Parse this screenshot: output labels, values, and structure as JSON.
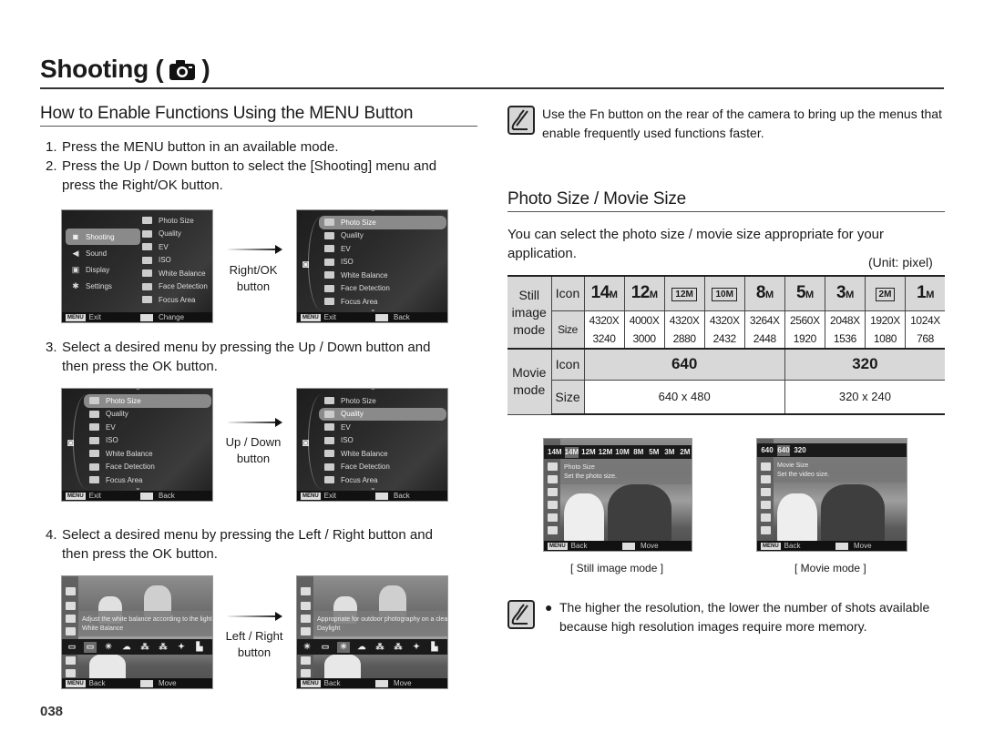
{
  "header": {
    "title": "Shooting (",
    "title_close": ")",
    "title_icon": "camera-icon"
  },
  "left": {
    "section_title": "How to Enable Functions Using the MENU Button",
    "steps": [
      {
        "num": "1.",
        "line1": "Press the MENU button in an available mode.",
        "line2": ""
      },
      {
        "num": "2.",
        "line1": "Press the Up / Down button to select the [Shooting] menu and",
        "line2": "press the Right/OK button."
      },
      {
        "num": "3.",
        "line1": "Select a desired menu by pressing the Up / Down button and",
        "line2": "then press the OK button."
      },
      {
        "num": "4.",
        "line1": "Select a desired menu by pressing the Left / Right button and",
        "line2": "then press the OK button."
      }
    ],
    "transitions": [
      {
        "line1": "Right/OK",
        "line2": "button"
      },
      {
        "line1": "Up / Down",
        "line2": "button"
      },
      {
        "line1": "Left / Right",
        "line2": "button"
      }
    ],
    "screen1": {
      "main_menu": [
        "Shooting",
        "Sound",
        "Display",
        "Settings"
      ],
      "sub_menu": [
        "Photo Size",
        "Quality",
        "EV",
        "ISO",
        "White Balance",
        "Face Detection",
        "Focus Area"
      ],
      "footer_left": "Exit",
      "footer_right": "Change",
      "menu_key": "MENU"
    },
    "submenu_screens": {
      "items": [
        "Photo Size",
        "Quality",
        "EV",
        "ISO",
        "White Balance",
        "Face Detection",
        "Focus Area"
      ],
      "footer_left": "Exit",
      "footer_right": "Back",
      "menu_key": "MENU",
      "selected_screen2": 0,
      "selected_screen3": 0,
      "selected_screen4": 1
    },
    "wb_screen_before": {
      "description": "Adjust the white balance according to the light source.",
      "title": "White Balance",
      "footer_left": "Back",
      "footer_right": "Move",
      "menu_key": "MENU"
    },
    "wb_screen_after": {
      "description": "Appropriate for outdoor photography on a clear day.",
      "title": "Daylight",
      "footer_left": "Back",
      "footer_right": "Move",
      "menu_key": "MENU"
    }
  },
  "right": {
    "note1": "Use the Fn button on the rear of the camera to bring up the menus that enable frequently used functions faster.",
    "section_title": "Photo Size / Movie Size",
    "intro": "You can select the photo size / movie size appropriate for your application.",
    "unit": "(Unit: pixel)",
    "table": {
      "still_mode_label": [
        "Still",
        "image",
        "mode"
      ],
      "movie_mode_label": [
        "Movie",
        "mode"
      ],
      "icon_label": "Icon",
      "size_label": "Size",
      "still_icons": [
        {
          "num": "14",
          "suffix": "M",
          "boxed": false
        },
        {
          "num": "12",
          "suffix": "M",
          "boxed": false
        },
        {
          "num": "12M",
          "suffix": "",
          "boxed": true
        },
        {
          "num": "10M",
          "suffix": "",
          "boxed": true
        },
        {
          "num": "8",
          "suffix": "M",
          "boxed": false
        },
        {
          "num": "5",
          "suffix": "M",
          "boxed": false
        },
        {
          "num": "3",
          "suffix": "M",
          "boxed": false
        },
        {
          "num": "2M",
          "suffix": "",
          "boxed": true
        },
        {
          "num": "1",
          "suffix": "M",
          "boxed": false
        }
      ],
      "still_sizes": [
        {
          "w": "4320X",
          "h": "3240"
        },
        {
          "w": "4000X",
          "h": "3000"
        },
        {
          "w": "4320X",
          "h": "2880"
        },
        {
          "w": "4320X",
          "h": "2432"
        },
        {
          "w": "3264X",
          "h": "2448"
        },
        {
          "w": "2560X",
          "h": "1920"
        },
        {
          "w": "2048X",
          "h": "1536"
        },
        {
          "w": "1920X",
          "h": "1080"
        },
        {
          "w": "1024X",
          "h": "768"
        }
      ],
      "movie_icons": [
        "640",
        "320"
      ],
      "movie_sizes": [
        "640 x 480",
        "320 x 240"
      ]
    },
    "still_screen": {
      "bar_items": [
        "14M",
        "14M",
        "12M",
        "12M",
        "10M",
        "8M",
        "5M",
        "3M",
        "2M"
      ],
      "title": "Photo Size",
      "description": "Set the photo size.",
      "footer_left": "Back",
      "footer_right": "Move",
      "menu_key": "MENU",
      "caption": "[ Still image mode ]"
    },
    "movie_screen": {
      "bar_items": [
        "640",
        "640",
        "320"
      ],
      "title": "Movie Size",
      "description": "Set the video size.",
      "footer_left": "Back",
      "footer_right": "Move",
      "menu_key": "MENU",
      "caption": "[ Movie mode ]"
    },
    "note2": "The higher the resolution, the lower the number of shots available because high resolution images require more memory."
  },
  "page_number": "038"
}
